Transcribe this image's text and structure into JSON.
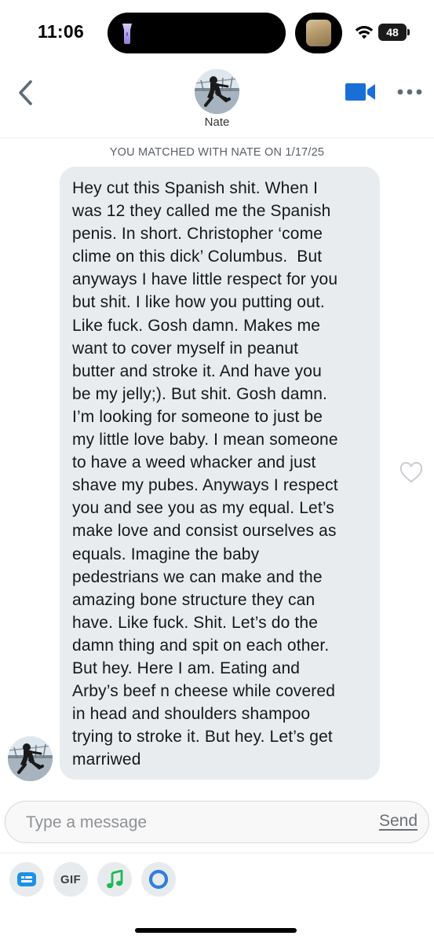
{
  "status_bar": {
    "time": "11:06",
    "battery_level": "48",
    "icons": [
      "flashlight-icon",
      "wifi-icon",
      "battery-icon"
    ]
  },
  "header": {
    "contact_name": "Nate",
    "icons": [
      "chevron-left-icon",
      "video-camera-icon",
      "more-horizontal-icon"
    ],
    "accent_color": "#1a6fd6"
  },
  "conversation": {
    "match_note": "YOU MATCHED WITH NATE ON 1/17/25",
    "messages": [
      {
        "sender": "Nate",
        "text": "Hey cut this Spanish shit. When I\nwas 12 they called me the Spanish\npenis. In short. Christopher ‘come\nclime on this dick’ Columbus.  But\nanyways I have little respect for you\nbut shit. I like how you putting out.\nLike fuck. Gosh damn. Makes me\nwant to cover myself in peanut\nbutter and stroke it. And have you\nbe my jelly;). But shit. Gosh damn.\nI’m looking for someone to just be\nmy little love baby. I mean someone\nto have a weed whacker and just\nshave my pubes. Anyways I respect\nyou and see you as my equal. Let’s\nmake love and consist ourselves as\nequals. Imagine the baby\npedestrians we can make and the\namazing bone structure they can\nhave. Like fuck. Shit. Let’s do the\ndamn thing and spit on each other.\nBut hey. Here I am. Eating and\nArby’s beef n cheese while covered\nin head and shoulders shampoo\ntrying to stroke it. But hey. Let’s get\nmarriwed"
      }
    ],
    "icons": [
      "heart-outline-icon"
    ]
  },
  "composer": {
    "placeholder": "Type a message",
    "value": "",
    "send_label": "Send"
  },
  "toolbar": {
    "gif_label": "GIF",
    "icons": [
      "sticker-card-icon",
      "music-note-icon",
      "ring-icon"
    ],
    "colors": {
      "blue": "#1e90e8",
      "green": "#1db954",
      "ring": "#2f7fe0"
    }
  }
}
